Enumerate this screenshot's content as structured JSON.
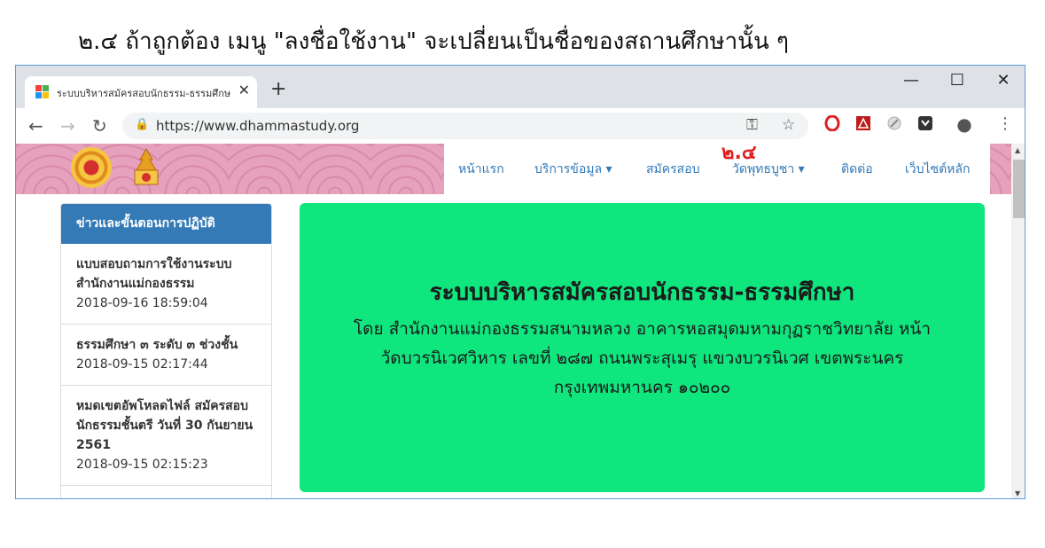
{
  "caption": "๒.๔ ถ้าถูกต้อง เมนู \"ลงชื่อใช้งาน\" จะเปลี่ยนเป็นชื่อของสถานศึกษานั้น ๆ",
  "browser": {
    "tab_title": "ระบบบริหารสมัครสอบนักธรรม-ธรรมศึกษ",
    "tab_close": "✕",
    "new_tab": "+",
    "minimize": "—",
    "maximize": "☐",
    "close": "✕",
    "back": "←",
    "forward": "→",
    "reload": "↻",
    "lock": "🔒",
    "url": "https://www.dhammastudy.org",
    "key": "⚿",
    "star": "☆",
    "menu": "⋮",
    "profile": "●"
  },
  "nav": {
    "items": [
      "หน้าแรก",
      "บริการข้อมูล ▾",
      "สมัครสอบ",
      "วัดพุทธบูชา ▾",
      "ติดต่อ",
      "เว็บไซต์หลัก"
    ],
    "marker": "๒.๔"
  },
  "sidebar": {
    "heading": "ข่าวและขั้นตอนการปฏิบัติ",
    "news": [
      {
        "title": "แบบสอบถามการใช้งานระบบสำนักงานแม่กองธรรม",
        "date": "2018-09-16 18:59:04"
      },
      {
        "title": "ธรรมศึกษา ๓ ระดับ ๓ ช่วงชั้น",
        "date": "2018-09-15 02:17:44"
      },
      {
        "title": "หมดเขตอัพโหลดไฟล์ สมัครสอบ นักธรรมชั้นตรี วันที่ 30 กันยายน 2561",
        "date": "2018-09-15 02:15:23"
      }
    ]
  },
  "hero": {
    "title": "ระบบบริหารสมัครสอบนักธรรม-ธรรมศึกษา",
    "address": "โดย สำนักงานแม่กองธรรมสนามหลวง อาคารหอสมุดมหามกุฏราชวิทยาลัย หน้าวัดบวรนิเวศวิหาร เลขที่ ๒๘๗ ถนนพระสุเมรุ แขวงบวรนิเวศ เขตพระนคร กรุงเทพมหานคร ๑๐๒๐๐"
  },
  "colors": {
    "accent": "#337ab7",
    "hero_bg": "#0fe67e",
    "marker": "#e02020",
    "banner_pink": "#e6a2bd"
  }
}
